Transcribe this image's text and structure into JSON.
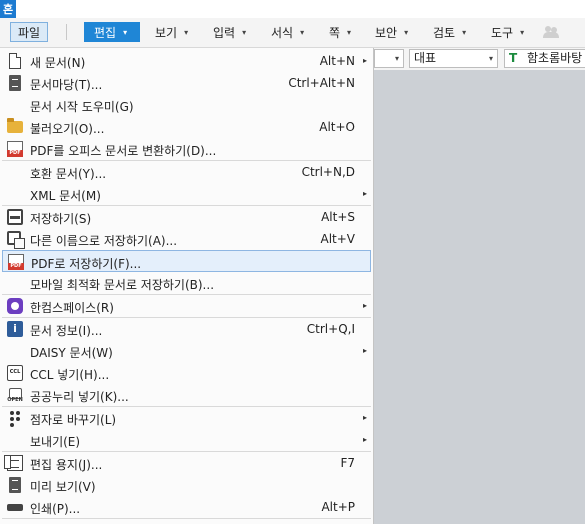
{
  "app_badge": "혼",
  "menubar": {
    "tabs": [
      {
        "label": "파일",
        "arrow": ""
      },
      {
        "label": "편집",
        "arrow": "▾"
      },
      {
        "label": "보기",
        "arrow": "▾"
      },
      {
        "label": "입력",
        "arrow": "▾"
      },
      {
        "label": "서식",
        "arrow": "▾"
      },
      {
        "label": "쪽",
        "arrow": "▾"
      },
      {
        "label": "보안",
        "arrow": "▾"
      },
      {
        "label": "검토",
        "arrow": "▾"
      },
      {
        "label": "도구",
        "arrow": "▾"
      }
    ]
  },
  "toolbar": {
    "style_value": "대표",
    "font_icon": "T",
    "font_value": "함초롬바탕",
    "arrow": "▾"
  },
  "menu": {
    "submenu_arrow": "▸",
    "items": [
      {
        "label": "새 문서(N)",
        "shortcut": "Alt+N",
        "submenu": true,
        "icon": "new-document-icon"
      },
      {
        "label": "문서마당(T)...",
        "shortcut": "Ctrl+Alt+N",
        "submenu": false,
        "icon": "document-template-icon"
      },
      {
        "label": "문서 시작 도우미(G)",
        "shortcut": "",
        "submenu": false,
        "icon": ""
      },
      {
        "label": "불러오기(O)...",
        "shortcut": "Alt+O",
        "submenu": false,
        "icon": "open-folder-icon"
      },
      {
        "label": "PDF를 오피스 문서로 변환하기(D)...",
        "shortcut": "",
        "submenu": false,
        "icon": "pdf-icon"
      },
      {
        "label": "호환 문서(Y)...",
        "shortcut": "Ctrl+N,D",
        "submenu": false,
        "icon": ""
      },
      {
        "label": "XML 문서(M)",
        "shortcut": "",
        "submenu": true,
        "icon": ""
      },
      {
        "label": "저장하기(S)",
        "shortcut": "Alt+S",
        "submenu": false,
        "icon": "save-icon"
      },
      {
        "label": "다른 이름으로 저장하기(A)...",
        "shortcut": "Alt+V",
        "submenu": false,
        "icon": "save-as-icon"
      },
      {
        "label": "PDF로 저장하기(F)...",
        "shortcut": "",
        "submenu": false,
        "icon": "save-pdf-icon"
      },
      {
        "label": "모바일 최적화 문서로 저장하기(B)...",
        "shortcut": "",
        "submenu": false,
        "icon": ""
      },
      {
        "label": "한컴스페이스(R)",
        "shortcut": "",
        "submenu": true,
        "icon": "hancom-space-icon"
      },
      {
        "label": "문서 정보(I)...",
        "shortcut": "Ctrl+Q,I",
        "submenu": false,
        "icon": "document-info-icon"
      },
      {
        "label": "DAISY 문서(W)",
        "shortcut": "",
        "submenu": true,
        "icon": ""
      },
      {
        "label": "CCL 넣기(H)...",
        "shortcut": "",
        "submenu": false,
        "icon": "ccl-icon"
      },
      {
        "label": "공공누리 넣기(K)...",
        "shortcut": "",
        "submenu": false,
        "icon": "open-license-icon"
      },
      {
        "label": "점자로 바꾸기(L)",
        "shortcut": "",
        "submenu": true,
        "icon": "braille-icon"
      },
      {
        "label": "보내기(E)",
        "shortcut": "",
        "submenu": true,
        "icon": ""
      },
      {
        "label": "편집 용지(J)...",
        "shortcut": "F7",
        "submenu": false,
        "icon": "page-setup-icon"
      },
      {
        "label": "미리 보기(V)",
        "shortcut": "",
        "submenu": false,
        "icon": "print-preview-icon"
      },
      {
        "label": "인쇄(P)...",
        "shortcut": "Alt+P",
        "submenu": false,
        "icon": "print-icon"
      }
    ]
  }
}
